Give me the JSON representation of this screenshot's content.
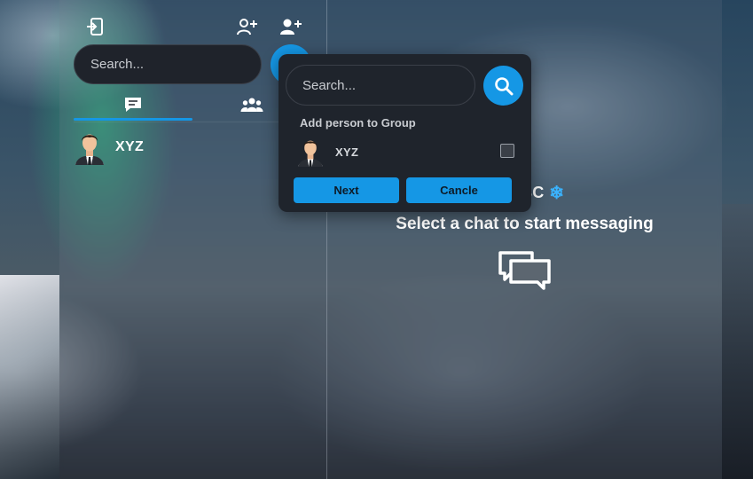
{
  "sidebar": {
    "search": {
      "placeholder": "Search..."
    },
    "contacts": [
      {
        "name": "XYZ"
      }
    ]
  },
  "welcome": {
    "greeting_name": "ABC",
    "greeting_emoji_left": "👋",
    "greeting_emoji_right": "❄",
    "prompt": "Select a chat to start messaging"
  },
  "popup": {
    "search": {
      "placeholder": "Search..."
    },
    "heading": "Add person to Group",
    "members": [
      {
        "name": "XYZ",
        "checked": false
      }
    ],
    "next_label": "Next",
    "cancel_label": "Cancle"
  },
  "colors": {
    "accent": "#1597e5",
    "panel": "#1f242c"
  },
  "icons": [
    "logout-icon",
    "add-user-icon",
    "add-group-user-icon",
    "chat-icon",
    "group-icon",
    "search-icon",
    "chat-bubbles-icon"
  ]
}
